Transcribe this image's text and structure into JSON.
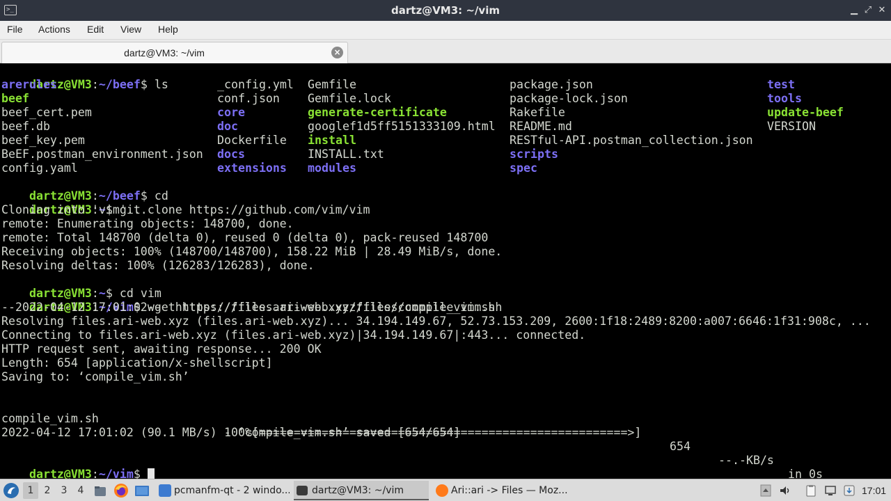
{
  "window": {
    "title": "dartz@VM3: ~/vim",
    "icon_label": ">_",
    "controls": {
      "minimize": "▁",
      "maximize": "⤢",
      "close": "✕"
    }
  },
  "menu": [
    "File",
    "Actions",
    "Edit",
    "View",
    "Help"
  ],
  "tab": {
    "label": "dartz@VM3: ~/vim",
    "close_label": "×"
  },
  "terminal": {
    "prompt_user": "dartz@VM3",
    "lines": {
      "l1_prompt": "dartz@VM3",
      "l1_path": "~/beef",
      "l1_cmd": "$ ls",
      "l13_prompt": "dartz@VM3",
      "l13_path": "~/beef",
      "l13_cmd": "$ cd",
      "l14_prompt": "dartz@VM3",
      "l14_path": "~",
      "l14_cmd": "$ git clone https://github.com/vim/vim",
      "l15": "Cloning into 'vim'...",
      "l16": "remote: Enumerating objects: 148700, done.",
      "l17": "remote: Total 148700 (delta 0), reused 0 (delta 0), pack-reused 148700",
      "l18": "Receiving objects: 100% (148700/148700), 158.22 MiB | 28.49 MiB/s, done.",
      "l19": "Resolving deltas: 100% (126283/126283), done.",
      "l20_prompt": "dartz@VM3",
      "l20_path": "~",
      "l20_cmd": "$ cd vim",
      "l21_prompt": "dartz@VM3",
      "l21_path": "~/vim",
      "l21_cmd": "$ wget https://files.ari-web.xyz/files/compile_vim.sh",
      "l22": "--2022-04-12 17:01:02--  https://files.ari-web.xyz/files/compile_vim.sh",
      "l23": "Resolving files.ari-web.xyz (files.ari-web.xyz)... 34.194.149.67, 52.73.153.209, 2600:1f18:2489:8200:a007:6646:1f31:908c, ...",
      "l24": "Connecting to files.ari-web.xyz (files.ari-web.xyz)|34.194.149.67|:443... connected.",
      "l25": "HTTP request sent, awaiting response... 200 OK",
      "l26": "Length: 654 [application/x-shellscript]",
      "l27": "Saving to: ‘compile_vim.sh’",
      "l29_name": "compile_vim.sh",
      "l29_pct": "100%[=====================================================>]",
      "l29_size": "654",
      "l29_rate": "--.-KB/s",
      "l29_time": "in 0s",
      "l31": "2022-04-12 17:01:02 (90.1 MB/s) - ‘compile_vim.sh’ saved [654/654]",
      "l33_prompt": "dartz@VM3",
      "l33_path": "~/vim",
      "l33_cmd": "$ "
    },
    "ls_columns": [
      [
        "arerules",
        "beef",
        "beef_cert.pem",
        "beef.db",
        "beef_key.pem",
        "BeEF.postman_environment.json",
        "config.yaml"
      ],
      [
        "_config.yml",
        "conf.json",
        "core",
        "doc",
        "Dockerfile",
        "docs",
        "extensions"
      ],
      [
        "Gemfile",
        "Gemfile.lock",
        "generate-certificate",
        "googlef1d5ff5151333109.html",
        "install",
        "INSTALL.txt",
        "modules"
      ],
      [
        "package.json",
        "package-lock.json",
        "Rakefile",
        "README.md",
        "RESTful-API.postman_collection.json",
        "scripts",
        "spec"
      ],
      [
        "test",
        "tools",
        "update-beef",
        "VERSION"
      ]
    ],
    "ls_types": [
      [
        "dir",
        "exe",
        "plain",
        "plain",
        "plain",
        "plain",
        "plain"
      ],
      [
        "plain",
        "plain",
        "dir",
        "dir",
        "plain",
        "dir",
        "dir"
      ],
      [
        "plain",
        "plain",
        "exe",
        "plain",
        "exe",
        "plain",
        "dir"
      ],
      [
        "plain",
        "plain",
        "plain",
        "plain",
        "plain",
        "dir",
        "dir"
      ],
      [
        "dir",
        "dir",
        "exe",
        "plain"
      ]
    ]
  },
  "taskbar": {
    "workspaces": [
      "1",
      "2",
      "3",
      "4"
    ],
    "active_workspace": "1",
    "tasks": [
      {
        "label": "pcmanfm-qt - 2 windo...",
        "icon": "folder-icon"
      },
      {
        "label": "dartz@VM3: ~/vim",
        "icon": "terminal-icon"
      },
      {
        "label": "Ari::ari -> Files — Moz...",
        "icon": "firefox-icon"
      }
    ],
    "clock": "17:01"
  },
  "colors": {
    "terminal_bg": "#000000",
    "prompt_green": "#8ae234",
    "path_blue": "#7c6ff4",
    "titlebar_bg": "#2f343f"
  }
}
